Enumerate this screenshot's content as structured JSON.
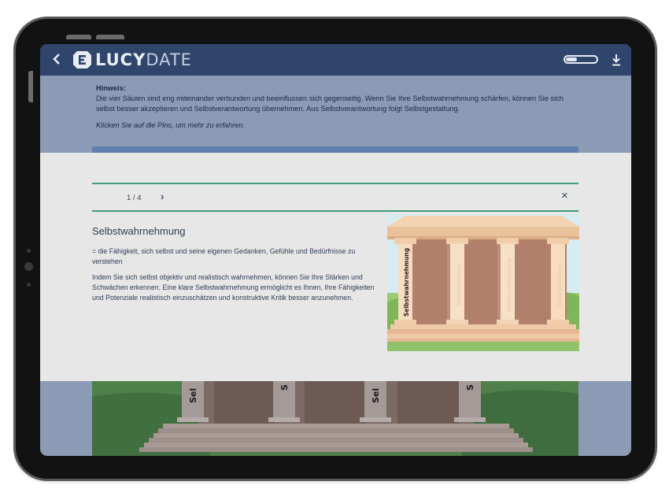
{
  "header": {
    "back_icon": "chevron-left-icon",
    "logo_lucy": "LUCY",
    "logo_date": "DATE",
    "toggle_icon": "toggle-icon",
    "download_icon": "download-icon"
  },
  "hint": {
    "title": "Hinweis:",
    "text": "Die vier Säulen sind eng miteinander verbunden und beeinflussen sich gegenseitig. Wenn Sie Ihre Selbstwahrnehmung schärfen, können Sie sich selbst besser akzeptieren und Selbstverantwortung übernehmen. Aus Selbstverantwortung folgt Selbstgestaltung.",
    "instruction": "Klicken Sie auf die Pins, um mehr zu erfahren."
  },
  "modal": {
    "pager": "1 / 4",
    "next": "›",
    "close": "×",
    "title": "Selbstwahrnehmung",
    "definition": "= die Fähigkeit, sich selbst und seine eigenen Gedanken, Gefühle und Bedürfnisse zu verstehen",
    "body": "Indem Sie sich selbst objektiv und realistisch wahrnehmen, können Sie Ihre Stärken und Schwächen erkennen. Eine klare Selbstwahrnehmung ermöglicht es Ihnen, Ihre Fähigkeiten und Potenziale realistisch einzuschätzen und konstruktive Kritik besser anzunehmen.",
    "pillar_label": "Selbstwahrnehmung",
    "faded_labels": [
      "Selbstakzeptanz",
      "Selbstverantwortung",
      "Selbstgestaltung"
    ]
  },
  "background_scene": {
    "pillar_labels": [
      "Sel",
      "S",
      "Sel",
      "S"
    ]
  },
  "colors": {
    "header_bg": "#2f456b",
    "overlay_bg": "#8b9bb6",
    "modal_bg": "#e7e7e7",
    "accent_rule": "#3f9c7c"
  }
}
